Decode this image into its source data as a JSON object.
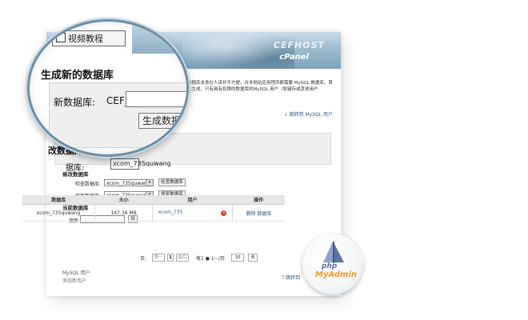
{
  "banner": {
    "brand_top": "CEFHOST",
    "brand_bottom": "cPanel"
  },
  "intro_text": "数据库本身在人读并不方便。许多网站应用程序都需要 MySQL 数据库。首先生成，只有具有权限的数据库的MySQL 用户（和键存或其他用户",
  "goto_mysql_users": "↓ 跳转到 MySQL 用户",
  "lens": {
    "video_button": "视频教程",
    "create_title": "生成新的数据库",
    "new_db_label": "新数据库:",
    "prefix": "CEF_",
    "new_db_value": "",
    "create_button": "生成数据库"
  },
  "modify": {
    "partial_title": "改数据库",
    "partial_label": "据库:",
    "section_title": "修改数据库",
    "check_label": "检查数据库:",
    "check_value": "xcom_735quwang",
    "check_button": "检查数据库",
    "repair_label": "修复数据库:",
    "repair_value": "xcom_735quwang",
    "repair_button": "修复数据库"
  },
  "current": {
    "section_title": "当前数据库",
    "search_label": "搜索",
    "search_value": "",
    "go_button": "到",
    "headers": [
      "数据库",
      "大小",
      "用户",
      "操作"
    ],
    "rows": [
      {
        "database": "xcom_735quwang",
        "size": "147.38 MB",
        "user": "xcom_735",
        "actions": "删除 数据库"
      }
    ]
  },
  "pager": {
    "page_label": "页:",
    "first": "第一",
    "current_page": "1",
    "last": "最后",
    "per_page_text": "每1 ● 1~/页:",
    "per_page_value": "10",
    "go": "去"
  },
  "mysql_users": {
    "title": "MySQL 用户",
    "add_user": "添加新用户",
    "hint_link": "? 跳转到"
  },
  "badge": {
    "php": "php",
    "myadmin": "MyAdmin"
  }
}
